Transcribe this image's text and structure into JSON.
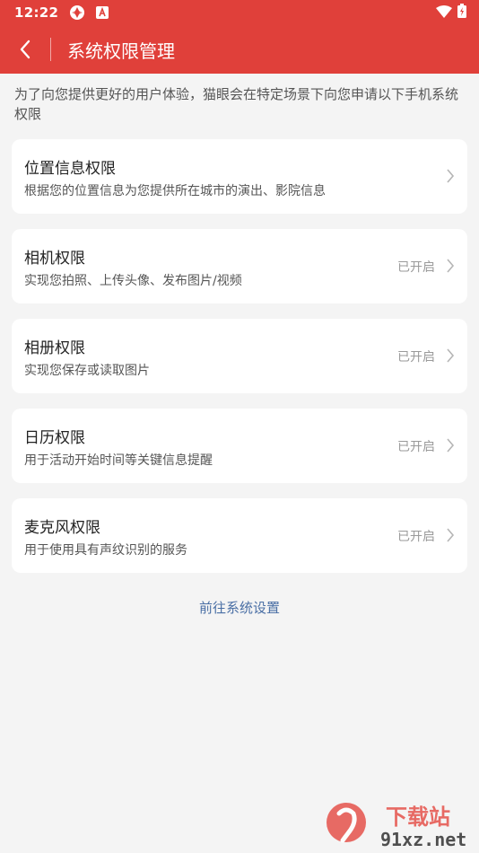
{
  "status_bar": {
    "time": "12:22"
  },
  "header": {
    "title": "系统权限管理"
  },
  "intro": "为了向您提供更好的用户体验，猫眼会在特定场景下向您申请以下手机系统权限",
  "permissions": [
    {
      "title": "位置信息权限",
      "desc": "根据您的位置信息为您提供所在城市的演出、影院信息",
      "status": ""
    },
    {
      "title": "相机权限",
      "desc": "实现您拍照、上传头像、发布图片/视频",
      "status": "已开启"
    },
    {
      "title": "相册权限",
      "desc": "实现您保存或读取图片",
      "status": "已开启"
    },
    {
      "title": "日历权限",
      "desc": "用于活动开始时间等关键信息提醒",
      "status": "已开启"
    },
    {
      "title": "麦克风权限",
      "desc": "用于使用具有声纹识别的服务",
      "status": "已开启"
    }
  ],
  "settings_link": "前往系统设置",
  "watermark": {
    "brand": "下载站",
    "site": "91xz.net"
  },
  "colors": {
    "primary": "#e0403a",
    "link": "#4a6fa5",
    "background": "#f4f4f4"
  }
}
